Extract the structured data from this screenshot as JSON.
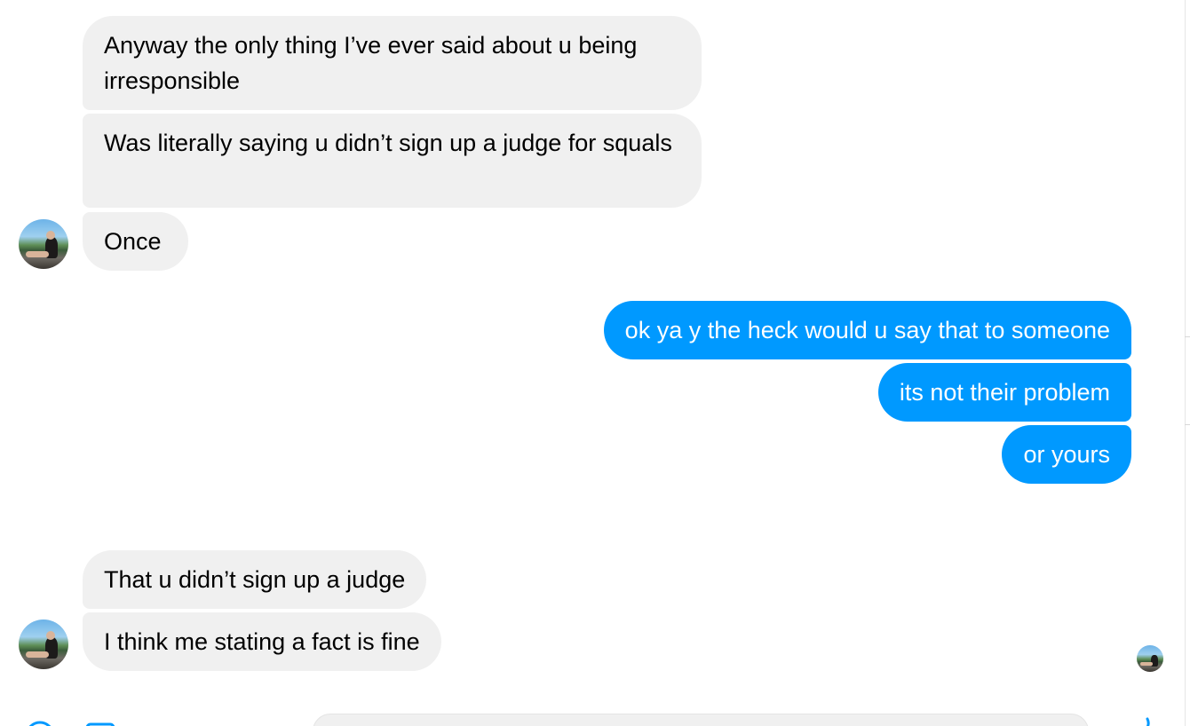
{
  "conversation": {
    "incoming_group_1": [
      "Anyway the only thing I’ve ever said about u being irresponsible",
      "Was literally saying u didn’t sign up a judge for squals",
      "Once"
    ],
    "outgoing_group_1": [
      "ok ya y the heck would u say that to someone",
      "its not their problem",
      "or yours"
    ],
    "incoming_group_2": [
      "That u didn’t sign up a judge",
      "I think me stating a fact is fine"
    ]
  },
  "colors": {
    "incoming_bubble": "#f0f0f0",
    "outgoing_bubble": "#0099ff",
    "incoming_text": "#000000",
    "outgoing_text": "#ffffff"
  },
  "icons": {
    "contact_avatar": "contact-avatar",
    "read_receipt": "read-receipt-avatar",
    "composer_left": [
      "add-icon",
      "gallery-icon"
    ],
    "composer_right": "like-icon"
  }
}
